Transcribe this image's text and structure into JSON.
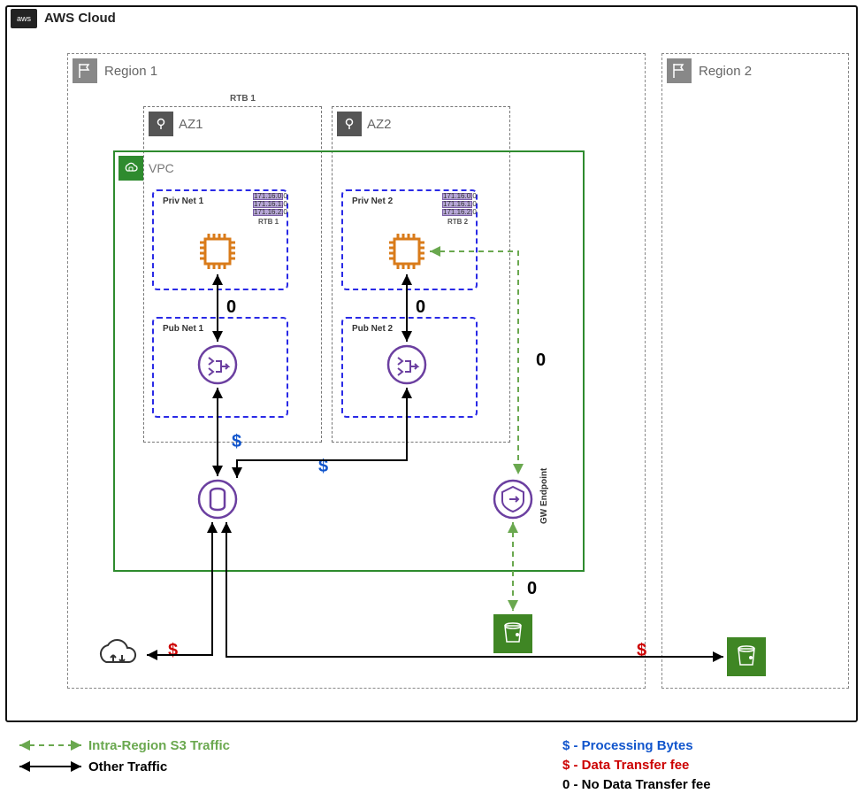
{
  "cloud": {
    "title": "AWS Cloud"
  },
  "region1": {
    "title": "Region 1"
  },
  "region2": {
    "title": "Region 2"
  },
  "rtb1_label": "RTB 1",
  "az1": {
    "title": "AZ1"
  },
  "az2": {
    "title": "AZ2"
  },
  "vpc": {
    "title": "VPC"
  },
  "privnet1": {
    "title": "Priv Net 1",
    "rtb": "RTB 1",
    "cidrs": [
      "171.16.0.0",
      "171.16.1.0",
      "171.16.2.0"
    ]
  },
  "privnet2": {
    "title": "Priv Net 2",
    "rtb": "RTB 2",
    "cidrs": [
      "171.16.0.0",
      "171.16.1.0",
      "171.16.2.0"
    ]
  },
  "pubnet1": {
    "title": "Pub Net 1"
  },
  "pubnet2": {
    "title": "Pub Net 2"
  },
  "gw_endpoint": "GW Endpoint",
  "costs": {
    "zero_priv1": "0",
    "zero_priv2": "0",
    "zero_endpoint_top": "0",
    "zero_endpoint_bottom": "0",
    "dollar_nat1": "$",
    "dollar_nat_shared": "$",
    "dollar_internet": "$",
    "dollar_interregion": "$"
  },
  "legend": {
    "intra": "Intra-Region S3 Traffic",
    "other": "Other Traffic",
    "processing": "$ - Processing Bytes",
    "transfer_fee": "$ - Data Transfer fee",
    "no_fee": "0 - No Data Transfer fee"
  },
  "colors": {
    "vpc_green": "#2e8b2e",
    "s3_green": "#3f8624",
    "subnet_blue": "#2a2ae6",
    "nat_purple": "#6b3fa0",
    "ec2_orange": "#d97b1a",
    "legend_green": "#6aa84f",
    "fee_red": "#cc0000",
    "proc_blue": "#1155cc"
  }
}
